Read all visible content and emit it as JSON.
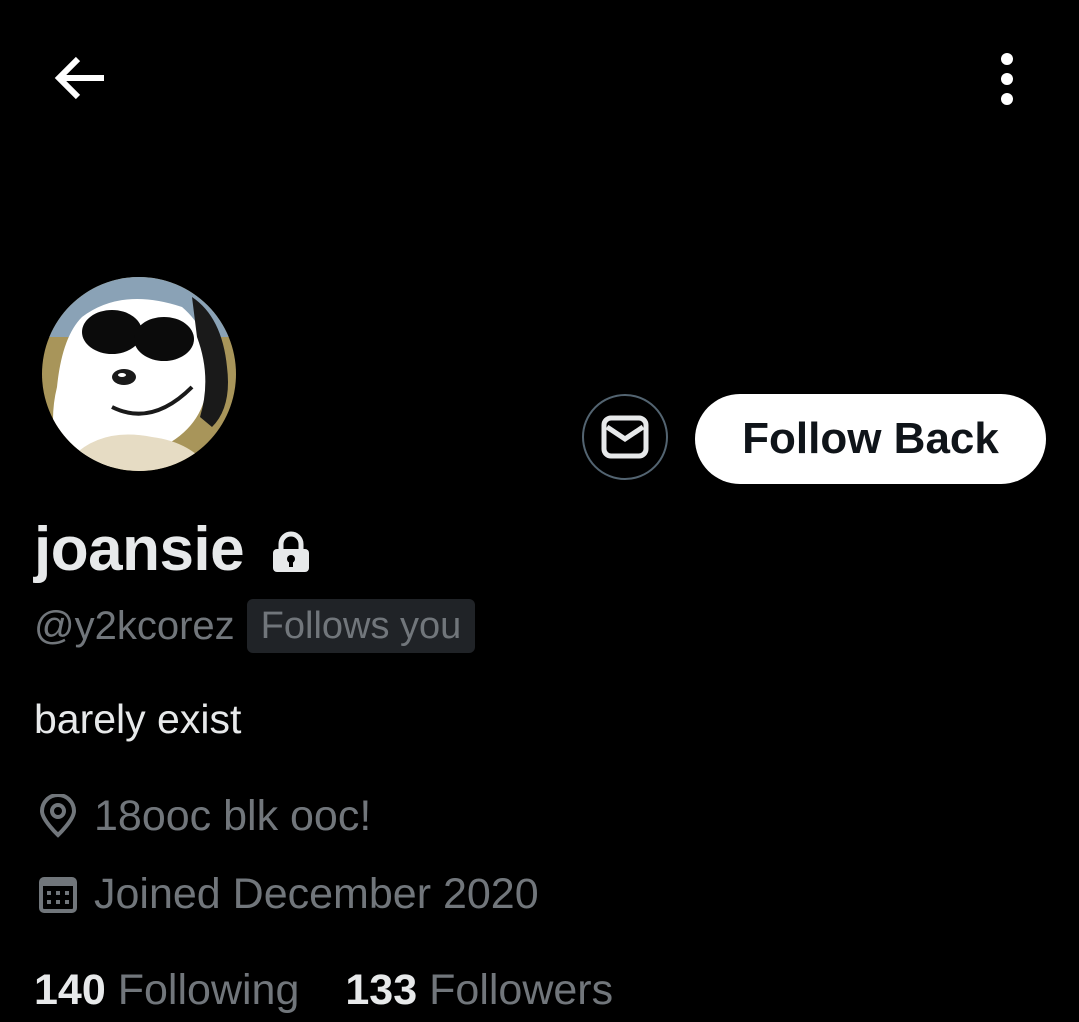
{
  "topbar": {
    "back_icon": "arrow-left-icon",
    "more_icon": "vertical-ellipsis-icon"
  },
  "profile": {
    "avatar_icon": "avatar-snoopy-sunglasses",
    "display_name": "joansie",
    "protected_icon": "lock-icon",
    "handle": "@y2kcorez",
    "follows_you": "Follows you",
    "bio": "barely exist",
    "location": "18ooc blk ooc!",
    "location_icon": "location-pin-icon",
    "joined": "Joined December 2020",
    "joined_icon": "calendar-icon"
  },
  "actions": {
    "message_icon": "envelope-icon",
    "follow_back_label": "Follow Back"
  },
  "stats": {
    "following_count": "140",
    "following_label": "Following",
    "followers_count": "133",
    "followers_label": "Followers"
  },
  "colors": {
    "background": "#000000",
    "primary_text": "#e7e9ea",
    "secondary_text": "#71767b",
    "button_bg": "#ffffff",
    "badge_bg": "#202327",
    "border": "#536471"
  }
}
